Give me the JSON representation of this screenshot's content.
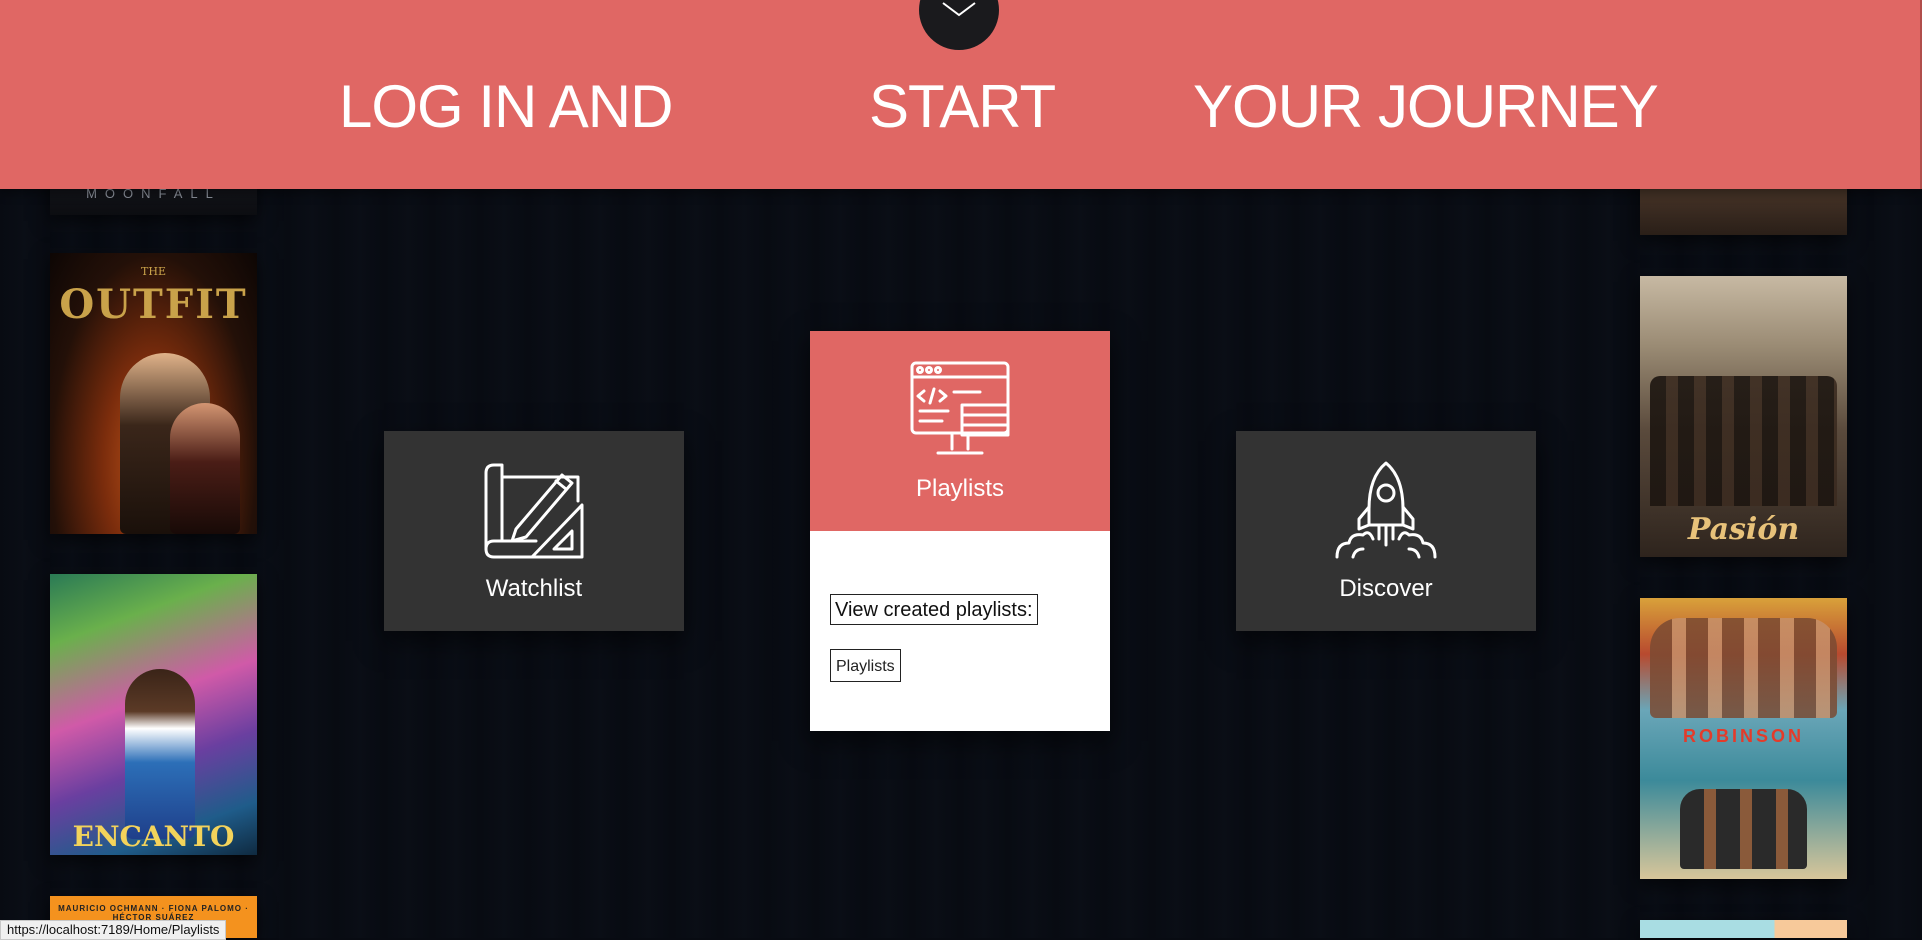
{
  "header": {
    "word1": "LOG IN AND",
    "word2": "START",
    "word3": "YOUR JOURNEY",
    "toggle_icon": "chevron-down-icon",
    "background": "#e06764"
  },
  "posters_left": [
    {
      "title": "MOONFALL"
    },
    {
      "title_small": "THE",
      "title": "OUTFIT"
    },
    {
      "title": "ENCANTO"
    },
    {
      "title": "MAURICIO OCHMANN · FIONA PALOMO · HÉCTOR SUÁREZ"
    }
  ],
  "posters_right": [
    {
      "title": ""
    },
    {
      "title": "Pasión"
    },
    {
      "title": "ROBINSON"
    },
    {
      "title": ""
    }
  ],
  "cards": {
    "watchlist": {
      "label": "Watchlist",
      "icon": "blueprint-pencil-icon"
    },
    "playlists": {
      "label": "Playlists",
      "icon": "code-monitor-icon",
      "view_button": "View created playlists:",
      "playlists_button": "Playlists"
    },
    "discover": {
      "label": "Discover",
      "icon": "rocket-icon"
    }
  },
  "status_bar": {
    "url": "https://localhost:7189/Home/Playlists"
  },
  "colors": {
    "accent": "#e06764",
    "card_dark": "#333333",
    "page_bg": "#080b12"
  }
}
